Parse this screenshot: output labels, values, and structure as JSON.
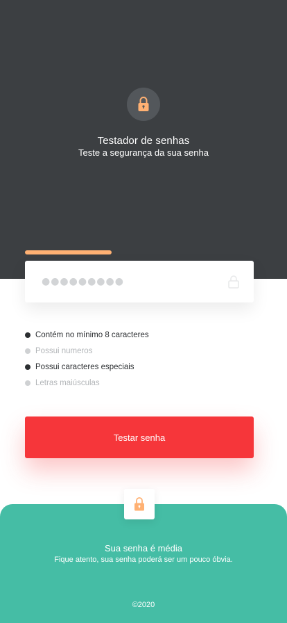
{
  "header": {
    "title": "Testador de senhas",
    "subtitle": "Teste a segurança da sua senha",
    "icon": "lock-icon"
  },
  "strength": {
    "level": 0.38,
    "color": "#ffb173"
  },
  "password_field": {
    "value": "●●●●●●●●●",
    "icon": "lock-icon"
  },
  "criteria": [
    {
      "label": "Contém no mínimo 8 caracteres",
      "met": true
    },
    {
      "label": "Possui numeros",
      "met": false
    },
    {
      "label": "Possui caracteres especiais",
      "met": true
    },
    {
      "label": "Letras maiúsculas",
      "met": false
    }
  ],
  "button": {
    "label": "Testar senha",
    "color": "#f6363a"
  },
  "result": {
    "title": "Sua senha é média",
    "message": "Fique atento, sua senha poderá ser um pouco óbvia.",
    "icon": "lock-icon",
    "color": "#45bda5"
  },
  "footer": {
    "copyright": "©2020"
  },
  "colors": {
    "header_bg": "#3c3f42",
    "accent": "#ffb173"
  }
}
